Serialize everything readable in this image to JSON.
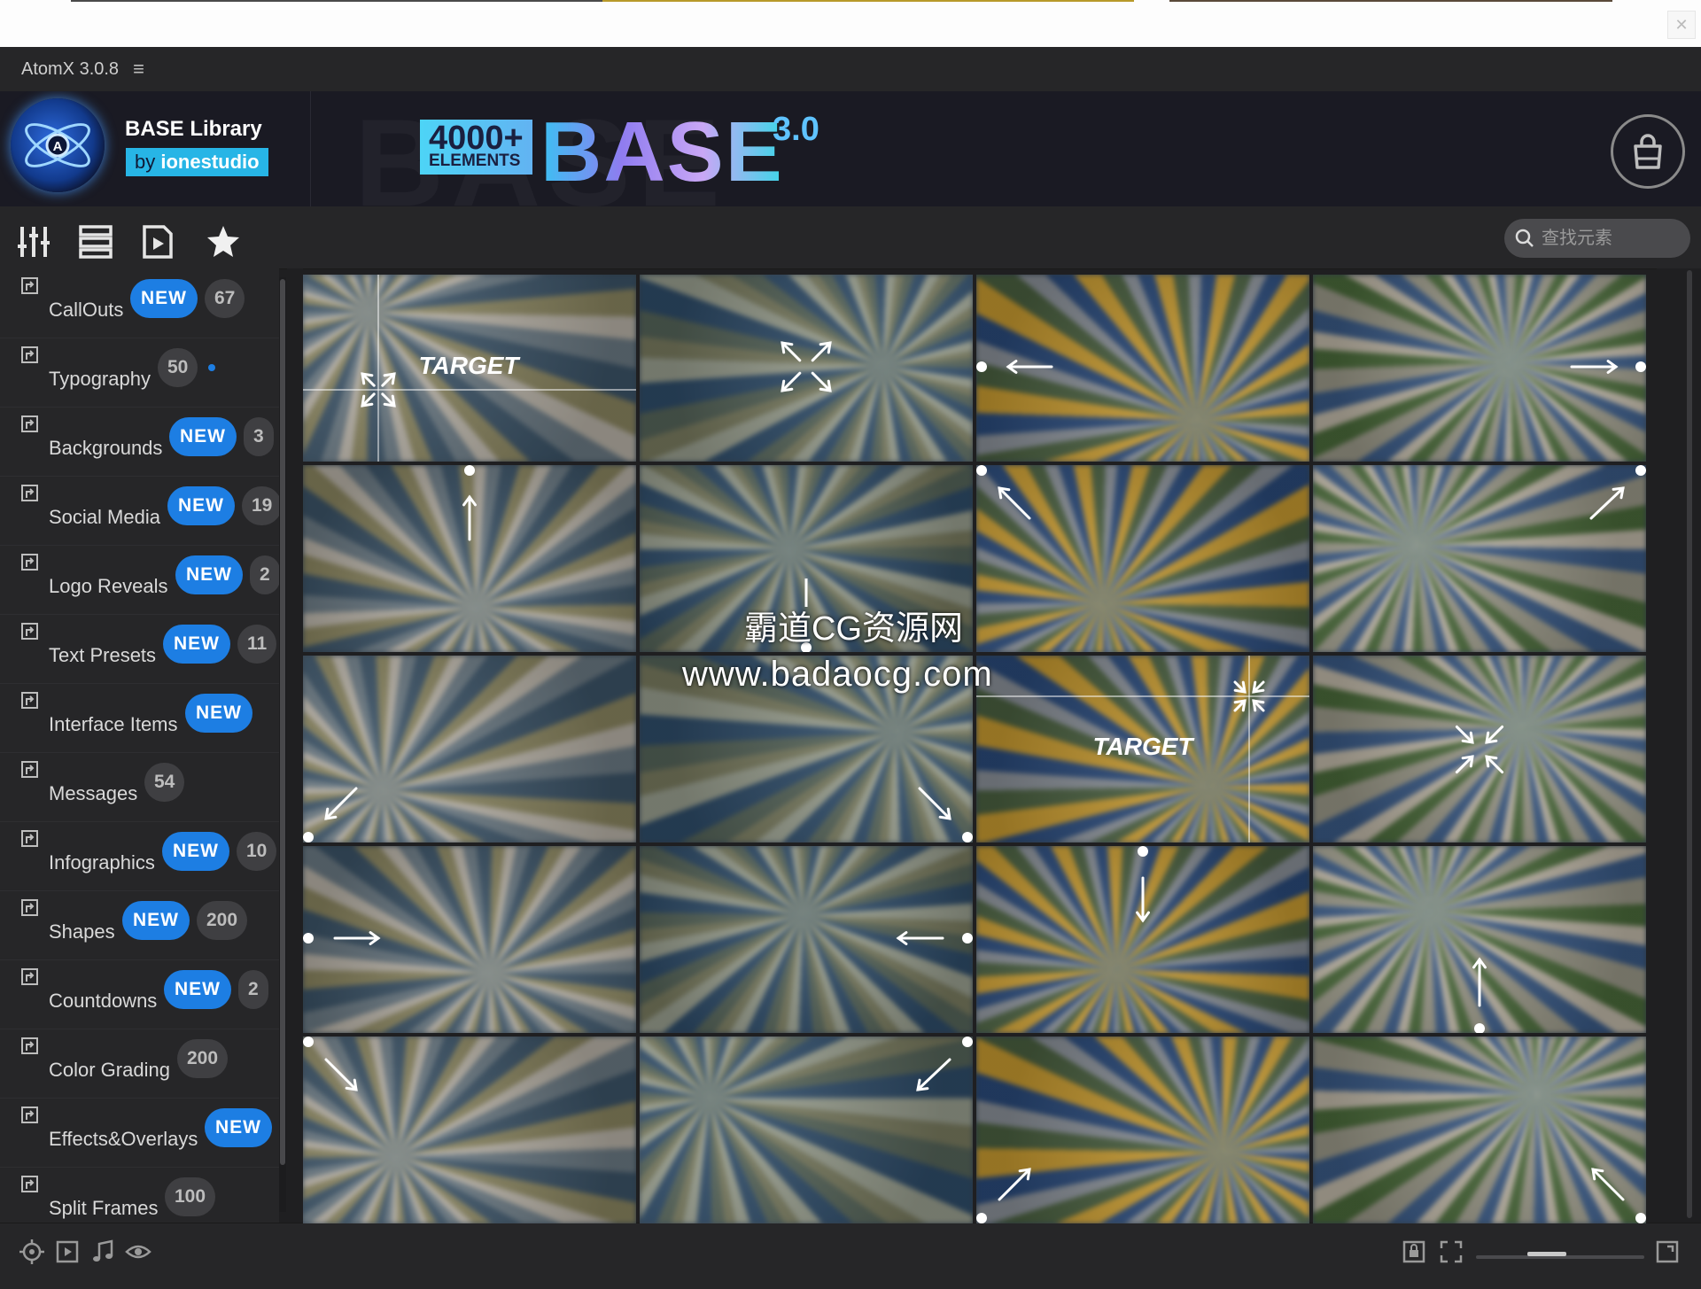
{
  "app": {
    "title": "AtomX 3.0.8",
    "menu_icon": "hamburger-icon"
  },
  "header": {
    "brand_title": "BASE Library",
    "brand_by": "by",
    "brand_author": "ionestudio",
    "banner_count": "4000+",
    "banner_elements": "ELEMENTS",
    "banner_name": "BASE",
    "banner_version": "3.0",
    "cart_icon": "shopping-bag-icon"
  },
  "toolbar": {
    "buttons": [
      "sliders-icon",
      "list-icon",
      "play-file-icon",
      "star-icon"
    ],
    "search_placeholder": "查找元素"
  },
  "sidebar": {
    "items": [
      {
        "label": "CallOuts",
        "new": "NEW",
        "count": "67"
      },
      {
        "label": "Typography",
        "count": "50",
        "dot": true
      },
      {
        "label": "Backgrounds",
        "new": "NEW",
        "count": "3"
      },
      {
        "label": "Social Media",
        "new": "NEW",
        "count": "19"
      },
      {
        "label": "Logo Reveals",
        "new": "NEW",
        "count": "2"
      },
      {
        "label": "Text Presets",
        "new": "NEW",
        "count": "11"
      },
      {
        "label": "Interface Items",
        "new": "NEW"
      },
      {
        "label": "Messages",
        "count": "54"
      },
      {
        "label": "Infographics",
        "new": "NEW",
        "count": "10"
      },
      {
        "label": "Shapes",
        "new": "NEW",
        "count": "200"
      },
      {
        "label": "Countdowns",
        "new": "NEW",
        "count": "2"
      },
      {
        "label": "Color Grading",
        "count": "200"
      },
      {
        "label": "Effects&Overlays",
        "new": "NEW"
      },
      {
        "label": "Split Frames",
        "count": "100"
      }
    ]
  },
  "grid": {
    "tiles": [
      {
        "overlay": "target-expand",
        "text": "TARGET"
      },
      {
        "overlay": "expand-corners"
      },
      {
        "overlay": "arrow-left"
      },
      {
        "overlay": "arrow-right"
      },
      {
        "overlay": "arrow-up"
      },
      {
        "overlay": "arrow-down-center"
      },
      {
        "overlay": "arrow-up-left"
      },
      {
        "overlay": "arrow-up-right"
      },
      {
        "overlay": "arrow-down-left"
      },
      {
        "overlay": "arrow-down-right"
      },
      {
        "overlay": "target-contract",
        "text": "TARGET"
      },
      {
        "overlay": "contract-center"
      },
      {
        "overlay": "arrow-right-in"
      },
      {
        "overlay": "arrow-left-in"
      },
      {
        "overlay": "arrow-down-in"
      },
      {
        "overlay": "arrow-up-in"
      },
      {
        "overlay": "arrow-down-right-in"
      },
      {
        "overlay": "arrow-down-left-in"
      },
      {
        "overlay": "arrow-up-right-in"
      },
      {
        "overlay": "arrow-up-left-in"
      }
    ]
  },
  "watermark": {
    "line1": "霸道CG资源网",
    "line2": "www.badaocg.com"
  },
  "footer": {
    "left_icons": [
      "target-icon",
      "play-box-icon",
      "music-note-icon",
      "eye-icon"
    ],
    "right_icons": [
      "lock-frame-icon",
      "fit-frame-icon",
      "expand-frame-icon"
    ],
    "zoom_level": 0.4
  }
}
